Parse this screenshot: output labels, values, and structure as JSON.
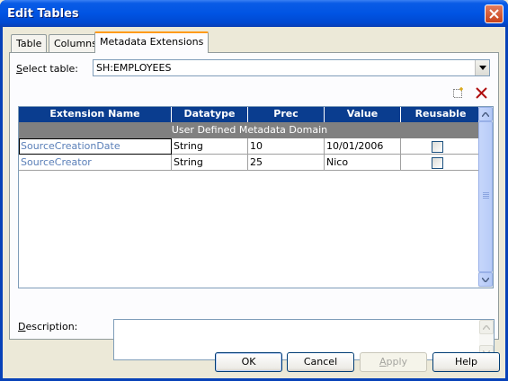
{
  "window": {
    "title": "Edit Tables"
  },
  "tabs": [
    {
      "label": "Table"
    },
    {
      "label": "Columns"
    },
    {
      "label": "Metadata Extensions"
    }
  ],
  "select_table": {
    "label_accel": "S",
    "label_rest": "elect table:",
    "value": "SH:EMPLOYEES"
  },
  "grid": {
    "columns": [
      "Extension Name",
      "Datatype",
      "Prec",
      "Value",
      "Reusable"
    ],
    "group": "User Defined Metadata Domain",
    "rows": [
      {
        "name": "SourceCreationDate",
        "datatype": "String",
        "prec": "10",
        "value": "10/01/2006",
        "reusable": false
      },
      {
        "name": "SourceCreator",
        "datatype": "String",
        "prec": "25",
        "value": "Nico",
        "reusable": false
      }
    ]
  },
  "description": {
    "label_accel": "D",
    "label_rest": "escription:",
    "value": ""
  },
  "buttons": {
    "ok": "OK",
    "cancel": "Cancel",
    "apply_accel": "A",
    "apply_rest": "pply",
    "help": "Help"
  },
  "icons": {
    "title_close": "close-icon",
    "combo_arrow": "chevron-down-icon",
    "new_row": "new-row-icon",
    "delete": "delete-icon"
  },
  "colors": {
    "header_bg": "#0a3d8f",
    "group_bg": "#808080",
    "name_text": "#5a7fb8",
    "delete_icon": "#b01010"
  }
}
